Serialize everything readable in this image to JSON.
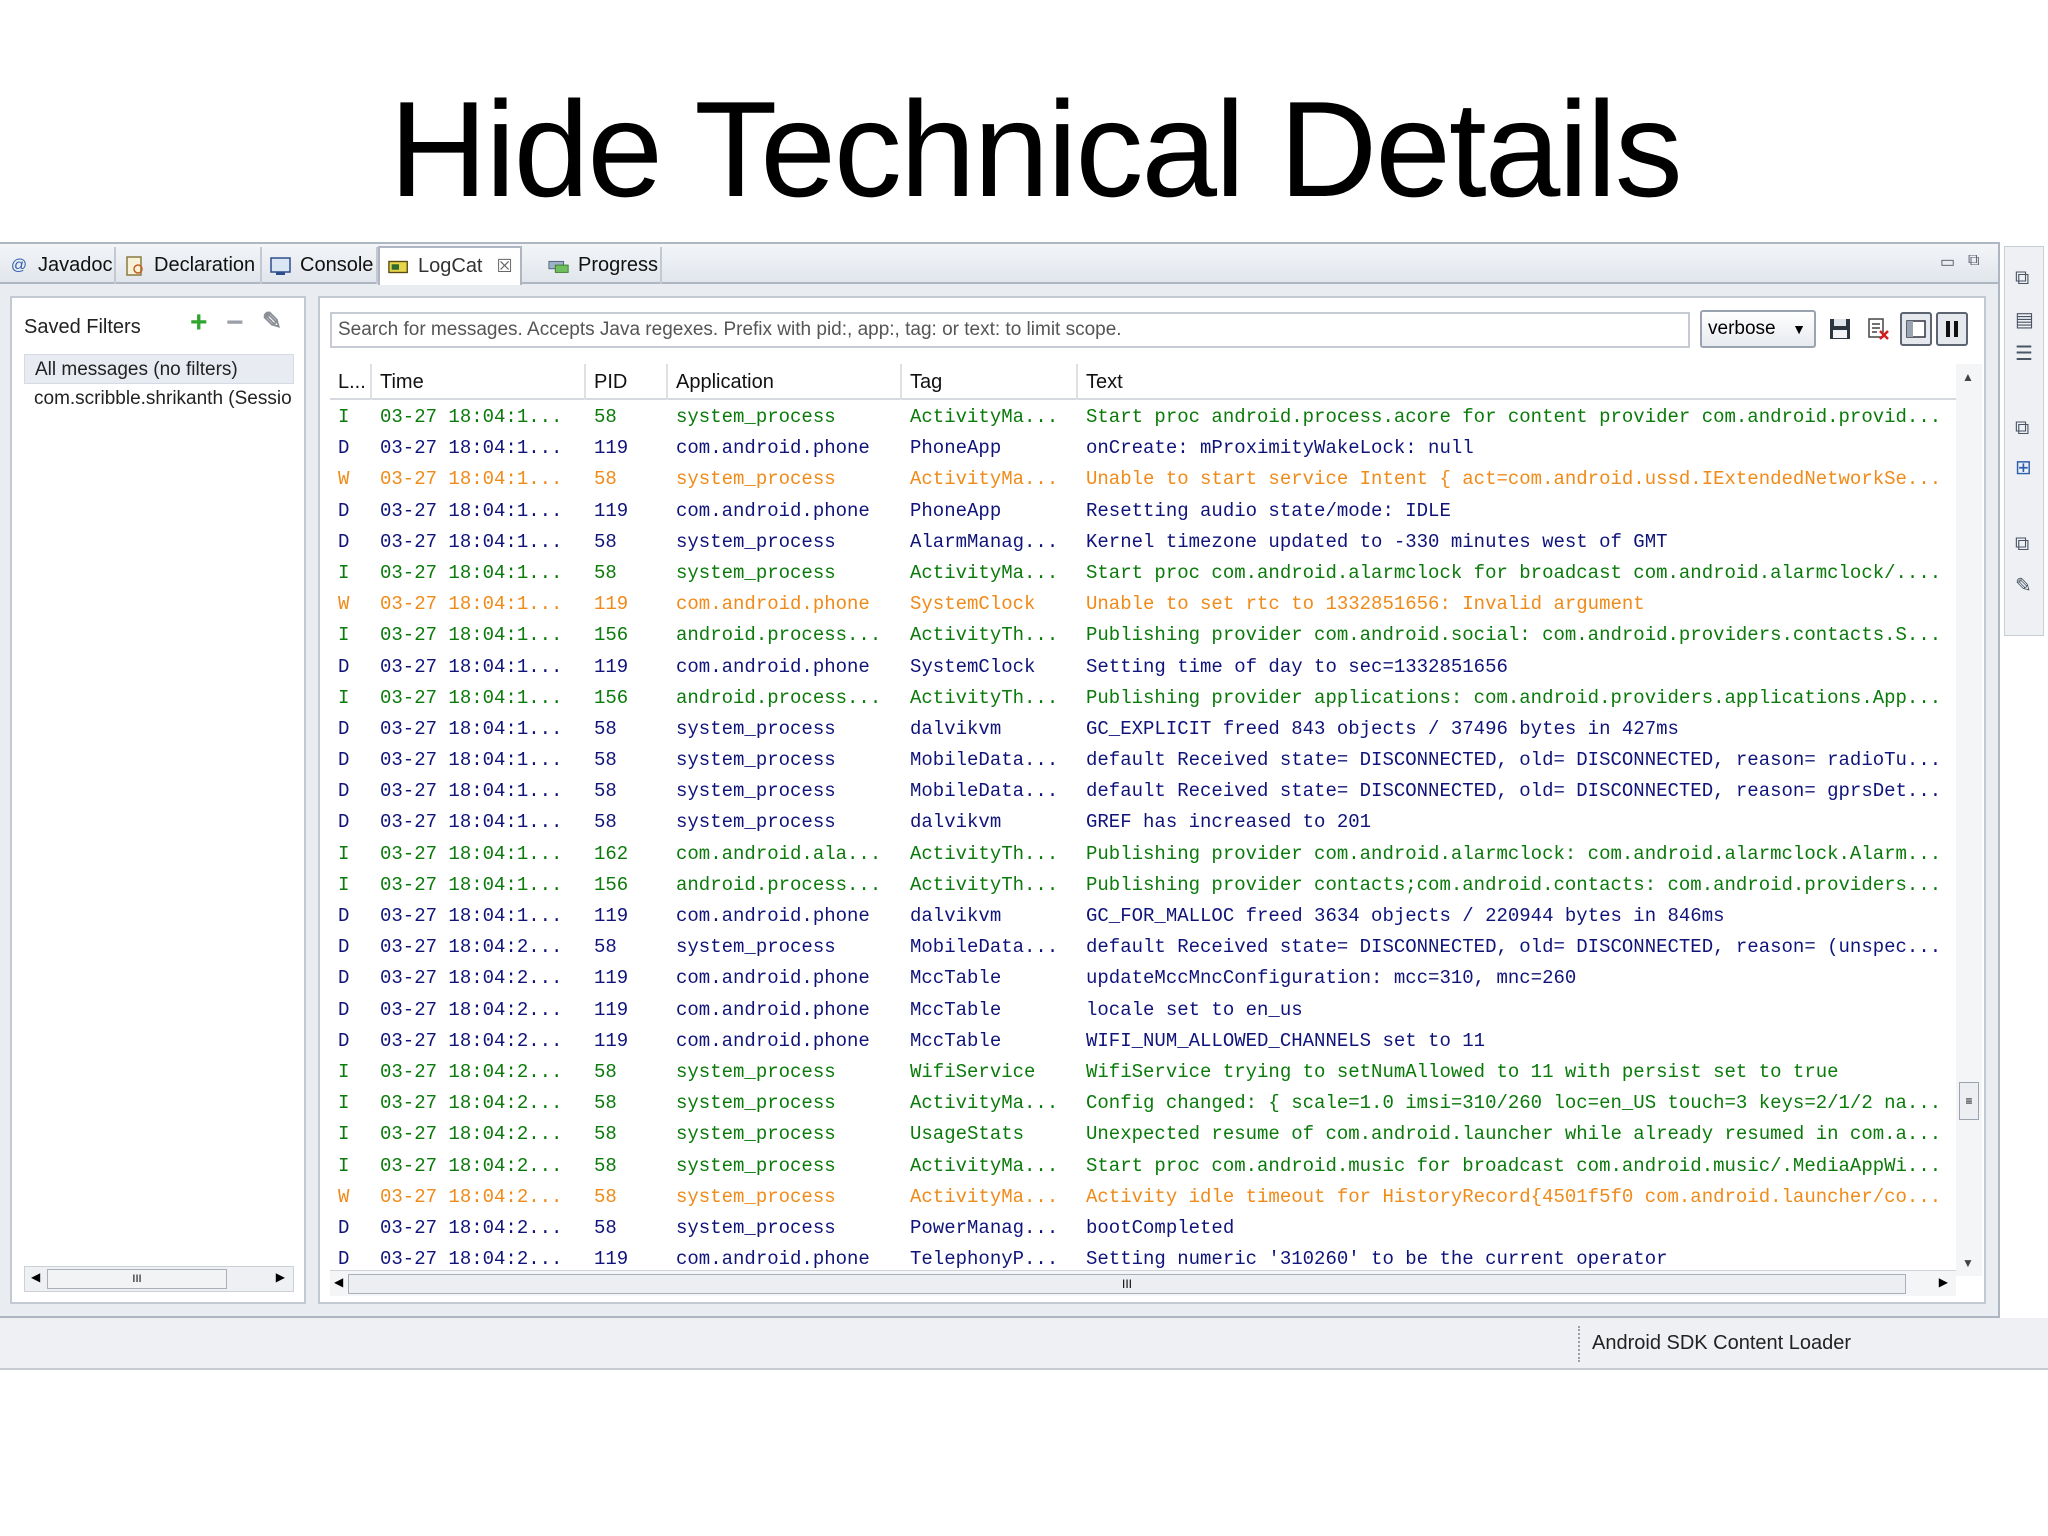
{
  "slide": {
    "title": "Hide Technical Details"
  },
  "tabs": [
    {
      "label": "Javadoc",
      "icon": "at-icon"
    },
    {
      "label": "Declaration",
      "icon": "declaration-icon"
    },
    {
      "label": "Console",
      "icon": "console-icon"
    },
    {
      "label": "LogCat",
      "icon": "logcat-icon",
      "active": true
    },
    {
      "label": "Progress",
      "icon": "progress-icon"
    }
  ],
  "filters": {
    "header": "Saved Filters",
    "items": [
      "All messages (no filters)",
      "com.scribble.shrikanth (Sessio"
    ]
  },
  "search": {
    "placeholder": "Search for messages. Accepts Java regexes. Prefix with pid:, app:, tag: or text: to limit scope."
  },
  "level_select": {
    "value": "verbose"
  },
  "table": {
    "columns": [
      "L...",
      "Time",
      "PID",
      "Application",
      "Tag",
      "Text"
    ],
    "rows": [
      [
        "I",
        "03-27 18:04:1...",
        "58",
        "system_process",
        "ActivityMa...",
        "Start proc android.process.acore for content provider com.android.provid..."
      ],
      [
        "D",
        "03-27 18:04:1...",
        "119",
        "com.android.phone",
        "PhoneApp",
        "onCreate: mProximityWakeLock: null"
      ],
      [
        "W",
        "03-27 18:04:1...",
        "58",
        "system_process",
        "ActivityMa...",
        "Unable to start service Intent { act=com.android.ussd.IExtendedNetworkSe..."
      ],
      [
        "D",
        "03-27 18:04:1...",
        "119",
        "com.android.phone",
        "PhoneApp",
        "Resetting audio state/mode: IDLE"
      ],
      [
        "D",
        "03-27 18:04:1...",
        "58",
        "system_process",
        "AlarmManag...",
        "Kernel timezone updated to -330 minutes west of GMT"
      ],
      [
        "I",
        "03-27 18:04:1...",
        "58",
        "system_process",
        "ActivityMa...",
        "Start proc com.android.alarmclock for broadcast com.android.alarmclock/...."
      ],
      [
        "W",
        "03-27 18:04:1...",
        "119",
        "com.android.phone",
        "SystemClock",
        "Unable to set rtc to 1332851656: Invalid argument"
      ],
      [
        "I",
        "03-27 18:04:1...",
        "156",
        "android.process...",
        "ActivityTh...",
        "Publishing provider com.android.social: com.android.providers.contacts.S..."
      ],
      [
        "D",
        "03-27 18:04:1...",
        "119",
        "com.android.phone",
        "SystemClock",
        "Setting time of day to sec=1332851656"
      ],
      [
        "I",
        "03-27 18:04:1...",
        "156",
        "android.process...",
        "ActivityTh...",
        "Publishing provider applications: com.android.providers.applications.App..."
      ],
      [
        "D",
        "03-27 18:04:1...",
        "58",
        "system_process",
        "dalvikvm",
        "GC_EXPLICIT freed 843 objects / 37496 bytes in 427ms"
      ],
      [
        "D",
        "03-27 18:04:1...",
        "58",
        "system_process",
        "MobileData...",
        "default Received state= DISCONNECTED, old= DISCONNECTED, reason= radioTu..."
      ],
      [
        "D",
        "03-27 18:04:1...",
        "58",
        "system_process",
        "MobileData...",
        "default Received state= DISCONNECTED, old= DISCONNECTED, reason= gprsDet..."
      ],
      [
        "D",
        "03-27 18:04:1...",
        "58",
        "system_process",
        "dalvikvm",
        "GREF has increased to 201"
      ],
      [
        "I",
        "03-27 18:04:1...",
        "162",
        "com.android.ala...",
        "ActivityTh...",
        "Publishing provider com.android.alarmclock: com.android.alarmclock.Alarm..."
      ],
      [
        "I",
        "03-27 18:04:1...",
        "156",
        "android.process...",
        "ActivityTh...",
        "Publishing provider contacts;com.android.contacts: com.android.providers..."
      ],
      [
        "D",
        "03-27 18:04:1...",
        "119",
        "com.android.phone",
        "dalvikvm",
        "GC_FOR_MALLOC freed 3634 objects / 220944 bytes in 846ms"
      ],
      [
        "D",
        "03-27 18:04:2...",
        "58",
        "system_process",
        "MobileData...",
        "default Received state= DISCONNECTED, old= DISCONNECTED, reason= (unspec..."
      ],
      [
        "D",
        "03-27 18:04:2...",
        "119",
        "com.android.phone",
        "MccTable",
        "updateMccMncConfiguration: mcc=310, mnc=260"
      ],
      [
        "D",
        "03-27 18:04:2...",
        "119",
        "com.android.phone",
        "MccTable",
        "locale set to en_us"
      ],
      [
        "D",
        "03-27 18:04:2...",
        "119",
        "com.android.phone",
        "MccTable",
        "WIFI_NUM_ALLOWED_CHANNELS set to 11"
      ],
      [
        "I",
        "03-27 18:04:2...",
        "58",
        "system_process",
        "WifiService",
        "WifiService trying to setNumAllowed to 11 with persist set to true"
      ],
      [
        "I",
        "03-27 18:04:2...",
        "58",
        "system_process",
        "ActivityMa...",
        "Config changed: { scale=1.0 imsi=310/260 loc=en_US touch=3 keys=2/1/2 na..."
      ],
      [
        "I",
        "03-27 18:04:2...",
        "58",
        "system_process",
        "UsageStats",
        "Unexpected resume of com.android.launcher while already resumed in com.a..."
      ],
      [
        "I",
        "03-27 18:04:2...",
        "58",
        "system_process",
        "ActivityMa...",
        "Start proc com.android.music for broadcast com.android.music/.MediaAppWi..."
      ],
      [
        "W",
        "03-27 18:04:2...",
        "58",
        "system_process",
        "ActivityMa...",
        "Activity idle timeout for HistoryRecord{4501f5f0 com.android.launcher/co..."
      ],
      [
        "D",
        "03-27 18:04:2...",
        "58",
        "system_process",
        "PowerManag...",
        "bootCompleted"
      ],
      [
        "D",
        "03-27 18:04:2...",
        "119",
        "com.android.phone",
        "TelephonyP...",
        "Setting numeric '310260' to be the current operator"
      ]
    ]
  },
  "statusbar": {
    "text": "Android SDK Content Loader"
  },
  "colors": {
    "info": "#0a7a0a",
    "debug": "#10147a",
    "warn": "#f08a18"
  }
}
